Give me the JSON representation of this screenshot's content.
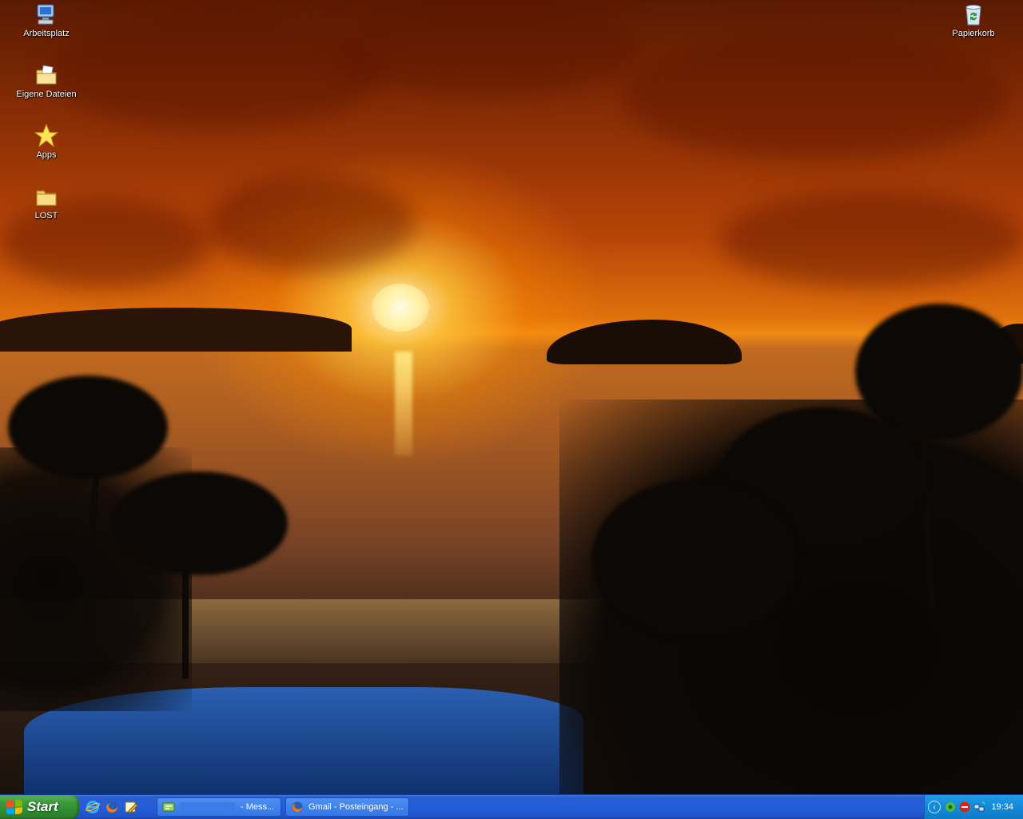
{
  "desktop": {
    "icons_left": [
      {
        "label": "Arbeitsplatz",
        "icon": "my-computer-icon"
      },
      {
        "label": "Eigene Dateien",
        "icon": "my-documents-icon"
      },
      {
        "label": "Apps",
        "icon": "star-icon"
      },
      {
        "label": "LOST",
        "icon": "folder-icon"
      }
    ],
    "icons_right": [
      {
        "label": "Papierkorb",
        "icon": "recycle-bin-icon"
      }
    ]
  },
  "taskbar": {
    "start_label": "Start",
    "quick_launch": [
      {
        "icon": "internet-explorer-icon"
      },
      {
        "icon": "firefox-icon"
      },
      {
        "icon": "edit-pencil-icon"
      }
    ],
    "tasks": [
      {
        "label": "- Mess...",
        "icon": "messenger-icon",
        "active": false
      },
      {
        "label": "Gmail - Posteingang - ...",
        "icon": "firefox-icon",
        "active": false
      }
    ],
    "tray": {
      "icons": [
        "show-hidden-icons-chevron",
        "antivirus-icon",
        "messenger-status-icon",
        "network-icon"
      ],
      "clock": "19:34"
    }
  },
  "colors": {
    "taskbar_blue": "#245ddb",
    "start_green": "#3c9a3c",
    "tray_blue": "#1389d8"
  }
}
